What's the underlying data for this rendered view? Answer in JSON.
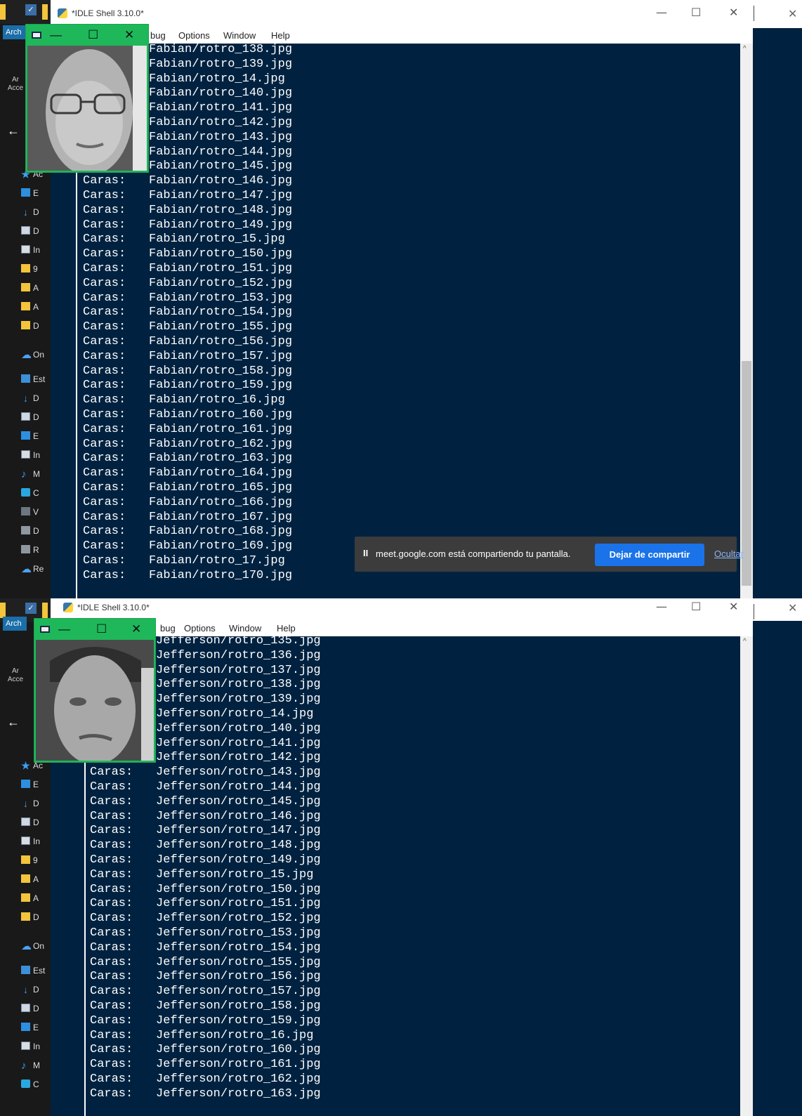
{
  "top": {
    "explorer": {
      "tab_label": "Arch",
      "access_label": "Ar\nAcce",
      "items": [
        {
          "label": "Ac",
          "icon": "star-icon"
        },
        {
          "label": "E",
          "icon": "desktop-icon"
        },
        {
          "label": "D",
          "icon": "download-icon"
        },
        {
          "label": "D",
          "icon": "document-icon"
        },
        {
          "label": "In",
          "icon": "image-icon"
        },
        {
          "label": "9",
          "icon": "folder-icon"
        },
        {
          "label": "A",
          "icon": "folder-icon"
        },
        {
          "label": "A",
          "icon": "folder-icon"
        },
        {
          "label": "D",
          "icon": "folder-icon"
        },
        {
          "label": "On",
          "icon": "cloud-icon"
        },
        {
          "label": "Est",
          "icon": "pc-icon"
        },
        {
          "label": "D",
          "icon": "download-icon"
        },
        {
          "label": "D",
          "icon": "document-icon"
        },
        {
          "label": "E",
          "icon": "desktop-icon"
        },
        {
          "label": "In",
          "icon": "image-icon"
        },
        {
          "label": "M",
          "icon": "music-icon"
        },
        {
          "label": "C",
          "icon": "3d-objects-icon"
        },
        {
          "label": "V",
          "icon": "video-icon"
        },
        {
          "label": "D",
          "icon": "drive-icon"
        },
        {
          "label": "R",
          "icon": "network-drive-icon"
        },
        {
          "label": "Re",
          "icon": "network-icon"
        }
      ]
    },
    "window_title": "*IDLE Shell 3.10.0*",
    "menu": {
      "partial": "bug",
      "options": "Options",
      "window": "Window",
      "help": "Help"
    },
    "prefix": "Caras:",
    "lines": [
      "Fabian/rotro_138.jpg",
      "Fabian/rotro_139.jpg",
      "Fabian/rotro_14.jpg",
      "Fabian/rotro_140.jpg",
      "Fabian/rotro_141.jpg",
      "Fabian/rotro_142.jpg",
      "Fabian/rotro_143.jpg",
      "Fabian/rotro_144.jpg",
      "Fabian/rotro_145.jpg",
      "Fabian/rotro_146.jpg",
      "Fabian/rotro_147.jpg",
      "Fabian/rotro_148.jpg",
      "Fabian/rotro_149.jpg",
      "Fabian/rotro_15.jpg",
      "Fabian/rotro_150.jpg",
      "Fabian/rotro_151.jpg",
      "Fabian/rotro_152.jpg",
      "Fabian/rotro_153.jpg",
      "Fabian/rotro_154.jpg",
      "Fabian/rotro_155.jpg",
      "Fabian/rotro_156.jpg",
      "Fabian/rotro_157.jpg",
      "Fabian/rotro_158.jpg",
      "Fabian/rotro_159.jpg",
      "Fabian/rotro_16.jpg",
      "Fabian/rotro_160.jpg",
      "Fabian/rotro_161.jpg",
      "Fabian/rotro_162.jpg",
      "Fabian/rotro_163.jpg",
      "Fabian/rotro_164.jpg",
      "Fabian/rotro_165.jpg",
      "Fabian/rotro_166.jpg",
      "Fabian/rotro_167.jpg",
      "Fabian/rotro_168.jpg",
      "Fabian/rotro_169.jpg",
      "Fabian/rotro_17.jpg",
      "Fabian/rotro_170.jpg"
    ],
    "notification": {
      "text": "meet.google.com está compartiendo tu pantalla.",
      "stop_label": "Dejar de compartir",
      "hide_label": "Ocultar"
    }
  },
  "bottom": {
    "explorer": {
      "tab_label": "Arch",
      "access_label": "Ar\nAcce",
      "items": [
        {
          "label": "Ac",
          "icon": "star-icon"
        },
        {
          "label": "E",
          "icon": "desktop-icon"
        },
        {
          "label": "D",
          "icon": "download-icon"
        },
        {
          "label": "D",
          "icon": "document-icon"
        },
        {
          "label": "In",
          "icon": "image-icon"
        },
        {
          "label": "9",
          "icon": "folder-icon"
        },
        {
          "label": "A",
          "icon": "folder-icon"
        },
        {
          "label": "A",
          "icon": "folder-icon"
        },
        {
          "label": "D",
          "icon": "folder-icon"
        },
        {
          "label": "On",
          "icon": "cloud-icon"
        },
        {
          "label": "Est",
          "icon": "pc-icon"
        },
        {
          "label": "D",
          "icon": "download-icon"
        },
        {
          "label": "D",
          "icon": "document-icon"
        },
        {
          "label": "E",
          "icon": "desktop-icon"
        },
        {
          "label": "In",
          "icon": "image-icon"
        },
        {
          "label": "M",
          "icon": "music-icon"
        },
        {
          "label": "C",
          "icon": "3d-objects-icon"
        }
      ]
    },
    "window_title": "*IDLE Shell 3.10.0*",
    "menu": {
      "partial": "bug",
      "options": "Options",
      "window": "Window",
      "help": "Help"
    },
    "prefix": "Caras:",
    "lines": [
      "Jefferson/rotro_135.jpg",
      "Jefferson/rotro_136.jpg",
      "Jefferson/rotro_137.jpg",
      "Jefferson/rotro_138.jpg",
      "Jefferson/rotro_139.jpg",
      "Jefferson/rotro_14.jpg",
      "Jefferson/rotro_140.jpg",
      "Jefferson/rotro_141.jpg",
      "Jefferson/rotro_142.jpg",
      "Jefferson/rotro_143.jpg",
      "Jefferson/rotro_144.jpg",
      "Jefferson/rotro_145.jpg",
      "Jefferson/rotro_146.jpg",
      "Jefferson/rotro_147.jpg",
      "Jefferson/rotro_148.jpg",
      "Jefferson/rotro_149.jpg",
      "Jefferson/rotro_15.jpg",
      "Jefferson/rotro_150.jpg",
      "Jefferson/rotro_151.jpg",
      "Jefferson/rotro_152.jpg",
      "Jefferson/rotro_153.jpg",
      "Jefferson/rotro_154.jpg",
      "Jefferson/rotro_155.jpg",
      "Jefferson/rotro_156.jpg",
      "Jefferson/rotro_157.jpg",
      "Jefferson/rotro_158.jpg",
      "Jefferson/rotro_159.jpg",
      "Jefferson/rotro_16.jpg",
      "Jefferson/rotro_160.jpg",
      "Jefferson/rotro_161.jpg",
      "Jefferson/rotro_162.jpg",
      "Jefferson/rotro_163.jpg"
    ]
  },
  "colors": {
    "shell_bg": "#002240",
    "shell_text": "#ffffff",
    "face_window_frame": "#1eb85a",
    "share_button": "#1a73e8"
  }
}
